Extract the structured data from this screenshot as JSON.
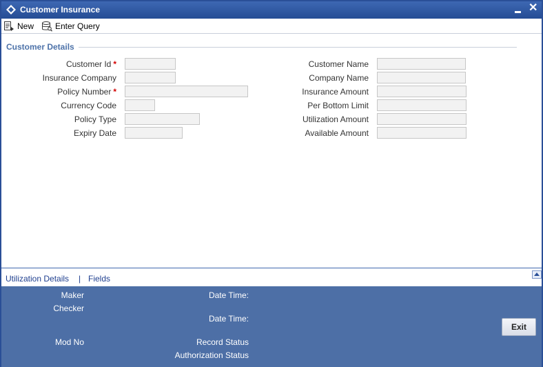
{
  "window": {
    "title": "Customer Insurance"
  },
  "toolbar": {
    "new_label": "New",
    "enter_query_label": "Enter Query"
  },
  "section": {
    "title": "Customer Details"
  },
  "left_fields": {
    "customer_id": {
      "label": "Customer Id",
      "value": ""
    },
    "insurance_company": {
      "label": "Insurance Company",
      "value": ""
    },
    "policy_number": {
      "label": "Policy Number",
      "value": ""
    },
    "currency_code": {
      "label": "Currency Code",
      "value": ""
    },
    "policy_type": {
      "label": "Policy Type",
      "value": ""
    },
    "expiry_date": {
      "label": "Expiry Date",
      "value": ""
    }
  },
  "right_fields": {
    "customer_name": {
      "label": "Customer Name",
      "value": ""
    },
    "company_name": {
      "label": "Company Name",
      "value": ""
    },
    "insurance_amount": {
      "label": "Insurance Amount",
      "value": ""
    },
    "per_bottom_limit": {
      "label": "Per Bottom Limit",
      "value": ""
    },
    "utilization_amount": {
      "label": "Utilization Amount",
      "value": ""
    },
    "available_amount": {
      "label": "Available Amount",
      "value": ""
    }
  },
  "required_marker": "*",
  "links": {
    "utilization_details": "Utilization Details",
    "separator": "|",
    "fields": "Fields"
  },
  "footer": {
    "maker": "Maker",
    "checker": "Checker",
    "date_time_1": "Date Time:",
    "date_time_2": "Date Time:",
    "mod_no": "Mod No",
    "record_status": "Record Status",
    "authorization_status": "Authorization Status",
    "exit_label": "Exit"
  },
  "colors": {
    "title_bar": "#2f5aa3",
    "footer": "#4d6fa6",
    "section_title": "#4d72a9",
    "link": "#1f3f8f",
    "required": "#d40000"
  },
  "icons": {
    "logo": "diamond-logo-icon",
    "minimize": "minimize-icon",
    "close": "close-icon",
    "new": "new-document-icon",
    "enter_query": "database-query-icon",
    "scroll_up": "scroll-up-arrow-icon"
  }
}
